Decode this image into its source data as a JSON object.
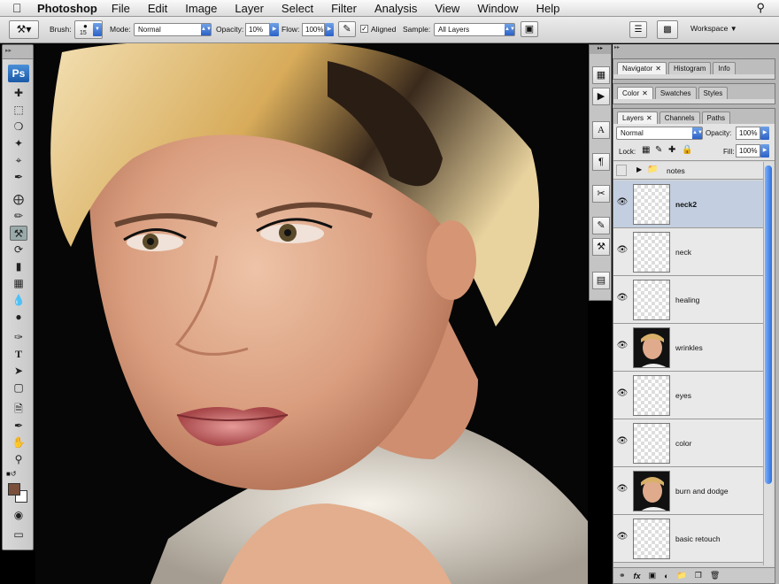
{
  "menubar": {
    "apple_icon": "apple-icon",
    "app_name": "Photoshop",
    "items": [
      "File",
      "Edit",
      "Image",
      "Layer",
      "Select",
      "Filter",
      "Analysis",
      "View",
      "Window",
      "Help"
    ],
    "search_icon": "spotlight-search-icon"
  },
  "options": {
    "brush_label": "Brush:",
    "brush_size": "15",
    "mode_label": "Mode:",
    "mode_value": "Normal",
    "opacity_label": "Opacity:",
    "opacity_value": "10%",
    "flow_label": "Flow:",
    "flow_value": "100%",
    "aligned_label": "Aligned",
    "aligned_checked": true,
    "sample_label": "Sample:",
    "sample_value": "All Layers",
    "workspace_label": "Workspace"
  },
  "toolbox": {
    "logo": "Ps",
    "active_tool": "clone-stamp-tool"
  },
  "panels": {
    "group1_tabs": [
      "Navigator",
      "Histogram",
      "Info"
    ],
    "group2_tabs": [
      "Color",
      "Swatches",
      "Styles"
    ],
    "group3_tabs": [
      "Layers",
      "Channels",
      "Paths"
    ],
    "blend_mode": "Normal",
    "opacity_label": "Opacity:",
    "opacity_value": "100%",
    "lock_label": "Lock:",
    "fill_label": "Fill:",
    "fill_value": "100%",
    "group_name": "notes",
    "layers": [
      {
        "name": "neck2",
        "selected": true,
        "thumb": "transparent"
      },
      {
        "name": "neck",
        "selected": false,
        "thumb": "transparent"
      },
      {
        "name": "healing",
        "selected": false,
        "thumb": "transparent"
      },
      {
        "name": "wrinkles",
        "selected": false,
        "thumb": "photo"
      },
      {
        "name": "eyes",
        "selected": false,
        "thumb": "transparent"
      },
      {
        "name": "color",
        "selected": false,
        "thumb": "transparent"
      },
      {
        "name": "burn and dodge",
        "selected": false,
        "thumb": "photo"
      },
      {
        "name": "basic retouch",
        "selected": false,
        "thumb": "transparent"
      }
    ]
  },
  "colors": {
    "foreground": "#7a4f3c",
    "background": "#ffffff",
    "selection": "#c3cfe0",
    "accent": "#2c62c8"
  }
}
